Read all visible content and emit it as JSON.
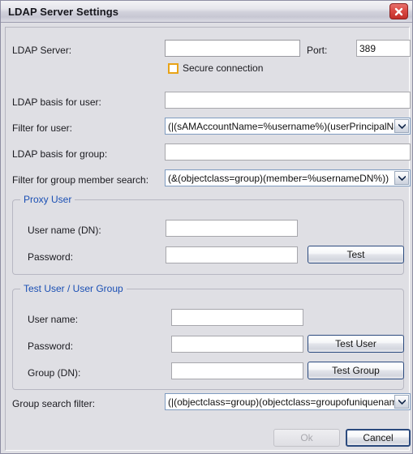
{
  "window": {
    "title": "LDAP Server Settings",
    "close_icon": "close-icon"
  },
  "form": {
    "ldap_server": {
      "label": "LDAP Server:",
      "value": "",
      "placeholder": ""
    },
    "port": {
      "label": "Port:",
      "value": "389"
    },
    "secure_connection": {
      "label": "Secure connection",
      "checked": false
    },
    "ldap_basis_user": {
      "label": "LDAP basis for user:",
      "value": ""
    },
    "filter_user": {
      "label": "Filter for user:",
      "value": "(|(sAMAccountName=%username%)(userPrincipalName=%"
    },
    "ldap_basis_group": {
      "label": "LDAP basis for group:",
      "value": ""
    },
    "filter_group_member": {
      "label": "Filter for group member search:",
      "value": "(&(objectclass=group)(member=%usernameDN%))"
    },
    "group_search_filter": {
      "label": "Group search filter:",
      "value": "(|(objectclass=group)(objectclass=groupofuniquenames))"
    }
  },
  "proxy_user": {
    "legend": "Proxy User",
    "user_name_label": "User name (DN):",
    "user_name_value": "",
    "password_label": "Password:",
    "password_value": "",
    "test_button": "Test"
  },
  "test_user_group": {
    "legend": "Test User / User Group",
    "user_name_label": "User name:",
    "user_name_value": "",
    "password_label": "Password:",
    "password_value": "",
    "group_dn_label": "Group (DN):",
    "group_dn_value": "",
    "test_user_button": "Test User",
    "test_group_button": "Test Group"
  },
  "footer": {
    "ok_label": "Ok",
    "ok_enabled": false,
    "cancel_label": "Cancel"
  },
  "colors": {
    "dialog_background": "#dfdfe4",
    "legend_blue": "#1a4fb4",
    "button_border": "#2b4a7e",
    "checkbox_highlight": "#e8a317",
    "close_button_red": "#c22f2a"
  }
}
